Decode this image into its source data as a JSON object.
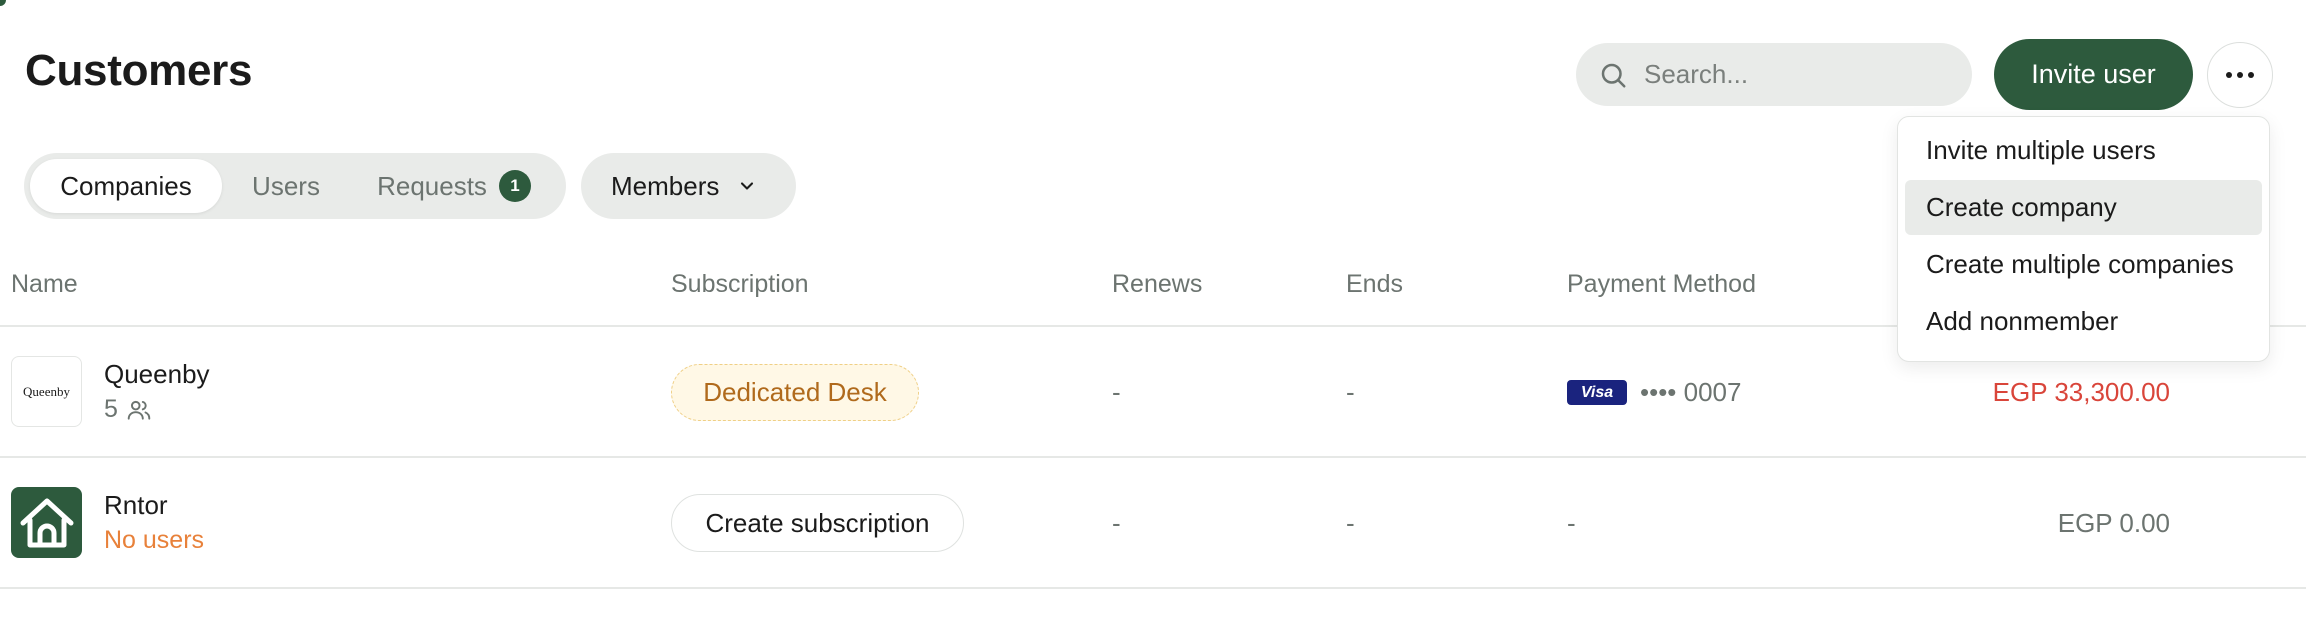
{
  "page": {
    "title": "Customers",
    "search_placeholder": "Search...",
    "invite_label": "Invite user",
    "brand_color": "#2d5a3d"
  },
  "tabs": [
    {
      "label": "Companies",
      "active": true
    },
    {
      "label": "Users",
      "active": false
    },
    {
      "label": "Requests",
      "active": false,
      "badge": "1"
    }
  ],
  "filter": {
    "label": "Members"
  },
  "table": {
    "headers": [
      "Name",
      "Subscription",
      "Renews",
      "Ends",
      "Payment Method"
    ],
    "rows": [
      {
        "logo_text": "Queenby",
        "name": "Queenby",
        "sub": "5",
        "sub_icon": "users-icon",
        "subscription": "Dedicated Desk",
        "renews": "-",
        "ends": "-",
        "card_brand": "Visa",
        "card_number": "•••• 0007",
        "amount": "EGP 33,300.00"
      },
      {
        "logo_icon": "house-icon",
        "name": "Rntor",
        "sub": "No users",
        "subscription": "Create subscription",
        "renews": "-",
        "ends": "-",
        "payment": "-",
        "amount": "EGP 0.00"
      }
    ]
  },
  "menu": {
    "items": [
      {
        "label": "Invite multiple users"
      },
      {
        "label": "Create company",
        "highlighted": true
      },
      {
        "label": "Create multiple companies"
      },
      {
        "label": "Add nonmember"
      }
    ]
  }
}
